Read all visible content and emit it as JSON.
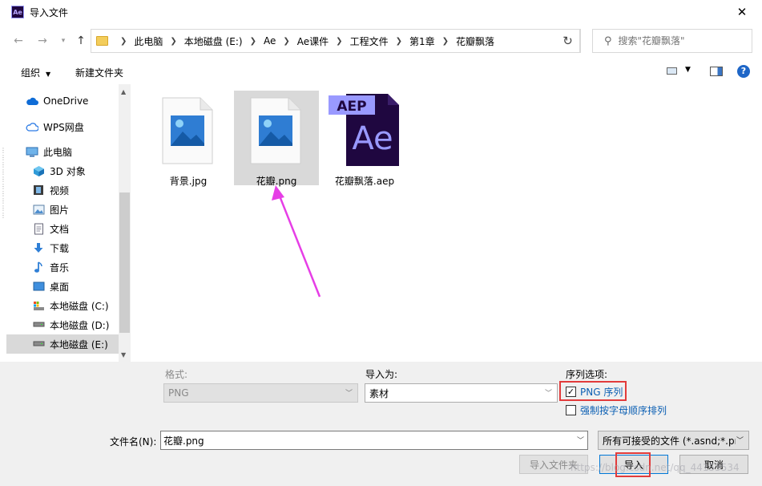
{
  "window": {
    "title": "导入文件",
    "app_icon_text": "Ae"
  },
  "address": {
    "crumbs": [
      "此电脑",
      "本地磁盘 (E:)",
      "Ae",
      "Ae课件",
      "工程文件",
      "第1章",
      "花瓣飘落"
    ]
  },
  "search": {
    "placeholder": "搜索\"花瓣飘落\""
  },
  "toolbar": {
    "organize": "组织",
    "new_folder": "新建文件夹",
    "help": "?"
  },
  "sidebar": {
    "items": [
      {
        "label": "OneDrive"
      },
      {
        "label": "WPS网盘"
      },
      {
        "label": "此电脑"
      },
      {
        "label": "3D 对象"
      },
      {
        "label": "视频"
      },
      {
        "label": "图片"
      },
      {
        "label": "文档"
      },
      {
        "label": "下载"
      },
      {
        "label": "音乐"
      },
      {
        "label": "桌面"
      },
      {
        "label": "本地磁盘 (C:)"
      },
      {
        "label": "本地磁盘 (D:)"
      },
      {
        "label": "本地磁盘 (E:)"
      }
    ]
  },
  "files": [
    {
      "name": "背景.jpg",
      "type": "image"
    },
    {
      "name": "花瓣.png",
      "type": "image",
      "selected": true
    },
    {
      "name": "花瓣飘落.aep",
      "type": "aep",
      "badge": "AEP",
      "mark": "Ae"
    }
  ],
  "options": {
    "format_label": "格式:",
    "format_value": "PNG",
    "import_as_label": "导入为:",
    "import_as_value": "素材",
    "sequence_label": "序列选项:",
    "png_sequence": {
      "label": "PNG 序列",
      "checked": true
    },
    "force_alpha": {
      "label": "强制按字母顺序排列",
      "checked": false
    }
  },
  "filename": {
    "label": "文件名(N):",
    "value": "花瓣.png",
    "filter": "所有可接受的文件 (*.asnd;*.pr"
  },
  "buttons": {
    "import_folder": "导入文件夹",
    "import": "导入",
    "cancel": "取消"
  },
  "watermark": "https://blog.csdn.net/qq_44153534",
  "colors": {
    "highlight_red": "#e23b3b",
    "arrow_magenta": "#e63ee6",
    "ae_purple": "#9999ff",
    "ae_bg": "#1f0740"
  }
}
